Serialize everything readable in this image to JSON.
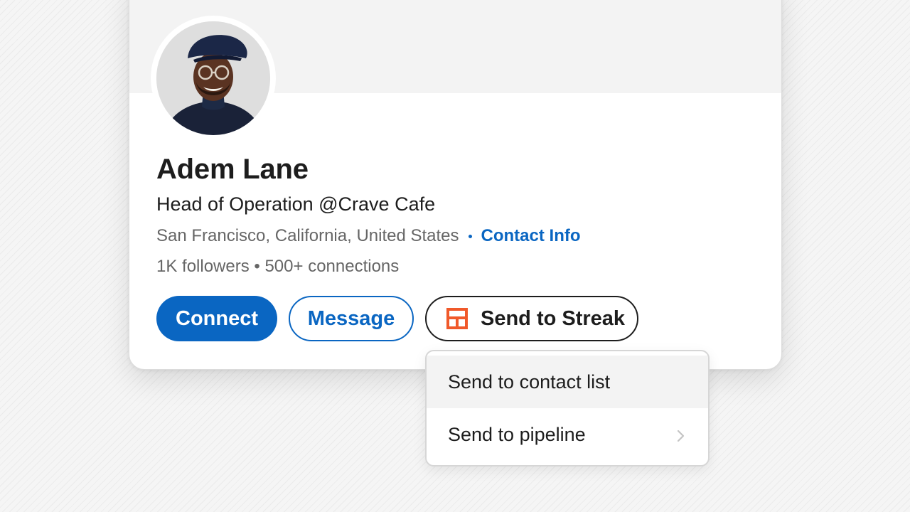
{
  "profile": {
    "name": "Adem Lane",
    "headline": "Head of Operation @Crave Cafe",
    "location": "San Francisco, California, United States",
    "contact_info_label": "Contact Info",
    "stats": "1K followers • 500+ connections"
  },
  "actions": {
    "connect_label": "Connect",
    "message_label": "Message",
    "streak_label": "Send to Streak",
    "streak_icon": "streak-icon"
  },
  "menu": {
    "items": [
      {
        "label": "Send to contact list"
      },
      {
        "label": "Send to pipeline",
        "icon": "chevron-right-icon"
      }
    ]
  },
  "colors": {
    "primary_blue": "#0a66c2",
    "streak_orange": "#f0592a",
    "text_dark": "#1d1d1d",
    "text_muted": "#666666"
  }
}
